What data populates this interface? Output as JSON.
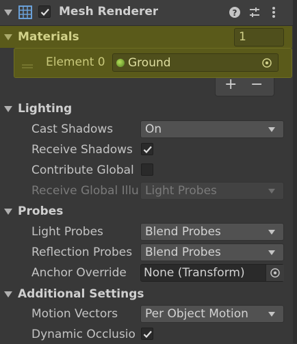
{
  "component": {
    "title": "Mesh Renderer",
    "enabled": true,
    "icons": [
      "mesh-renderer-icon",
      "help-icon",
      "presets-icon",
      "kebab-menu-icon"
    ]
  },
  "materials": {
    "label": "Materials",
    "size": "1",
    "element_label": "Element 0",
    "element_value": "Ground",
    "highlight_color": "#5a5a1a",
    "add_label": "+",
    "remove_label": "−"
  },
  "lighting": {
    "label": "Lighting",
    "cast_shadows": {
      "label": "Cast Shadows",
      "value": "On"
    },
    "receive_shadows": {
      "label": "Receive Shadows",
      "checked": true
    },
    "contribute_global": {
      "label": "Contribute Global",
      "checked": false
    },
    "receive_global": {
      "label": "Receive Global Illu",
      "value": "Light Probes"
    }
  },
  "probes": {
    "label": "Probes",
    "light_probes": {
      "label": "Light Probes",
      "value": "Blend Probes"
    },
    "reflection_probes": {
      "label": "Reflection Probes",
      "value": "Blend Probes"
    },
    "anchor_override": {
      "label": "Anchor Override",
      "value": "None (Transform)"
    }
  },
  "additional": {
    "label": "Additional Settings",
    "motion_vectors": {
      "label": "Motion Vectors",
      "value": "Per Object Motion"
    },
    "dynamic_occlusion": {
      "label": "Dynamic Occlusio",
      "checked": true
    }
  }
}
